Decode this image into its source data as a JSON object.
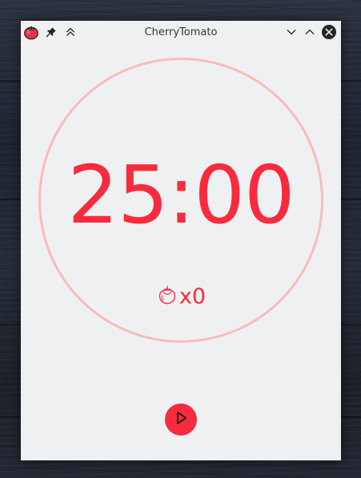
{
  "window": {
    "title": "CherryTomato"
  },
  "titlebar": {
    "app_icon": "tomato-icon",
    "left_buttons": [
      "pin-icon",
      "keep-above-icon"
    ],
    "right_buttons": [
      "minimize-icon",
      "maximize-icon",
      "close-icon"
    ]
  },
  "timer": {
    "display": "25:00",
    "progress_fraction": 1.0
  },
  "counter": {
    "icon": "tomato-outline-icon",
    "text": "x0"
  },
  "controls": {
    "play_icon": "play-icon"
  },
  "colors": {
    "accent": "#f72b3d",
    "ring": "#f8bcbb",
    "background": "#eff0f1",
    "title_text": "#31363b"
  }
}
